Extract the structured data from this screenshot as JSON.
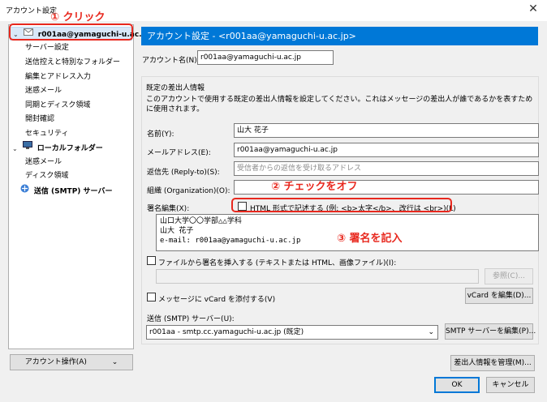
{
  "window": {
    "title": "アカウント設定",
    "close_glyph": "✕"
  },
  "sidebar": {
    "account": "r001aa@yamaguchi-u.ac.jp",
    "items": [
      {
        "label": "サーバー設定"
      },
      {
        "label": "送信控えと特別なフォルダー"
      },
      {
        "label": "編集とアドレス入力"
      },
      {
        "label": "迷惑メール"
      },
      {
        "label": "同期とディスク領域"
      },
      {
        "label": "開封確認"
      },
      {
        "label": "セキュリティ"
      }
    ],
    "local_folders": "ローカルフォルダー",
    "local_items": [
      {
        "label": "迷惑メール"
      },
      {
        "label": "ディスク領域"
      }
    ],
    "smtp": "送信 (SMTP) サーバー",
    "account_ops": "アカウント操作(A)",
    "account_ops_chevron": "⌄"
  },
  "main": {
    "header": "アカウント設定 - <r001aa@yamaguchi-u.ac.jp>",
    "account_name_label": "アカウント名(N):",
    "account_name_value": "r001aa@yamaguchi-u.ac.jp",
    "identity_heading": "既定の差出人情報",
    "identity_desc": "このアカウントで使用する既定の差出人情報を設定してください。これはメッセージの差出人が誰であるかを表すために使用されます。",
    "name_label": "名前(Y):",
    "name_value": "山大 花子",
    "email_label": "メールアドレス(E):",
    "email_value": "r001aa@yamaguchi-u.ac.jp",
    "replyto_label": "返信先 (Reply-to)(S):",
    "replyto_placeholder": "受信者からの返信を受け取るアドレス",
    "org_label": "組織 (Organization)(O):",
    "org_value": "",
    "sig_label": "署名編集(X):",
    "html_checkbox_label": "HTML 形式で記述する (例: <b>太字</b>、改行は <br>)(L)",
    "signature_text": "山口大学〇〇学部△△学科\n山大 花子\ne-mail: r001aa@yamaguchi-u.ac.jp",
    "sig_file_label": "ファイルから署名を挿入する (テキストまたは HTML、画像ファイル)(I):",
    "browse_button": "参照(C)...",
    "vcard_label": "メッセージに vCard を添付する(V)",
    "vcard_button": "vCard を編集(D)...",
    "smtp_label": "送信 (SMTP) サーバー(U):",
    "smtp_value": "r001aa - smtp.cc.yamaguchi-u.ac.jp (既定)",
    "smtp_button": "SMTP サーバーを編集(P)...",
    "manage_identities": "差出人情報を管理(M)...",
    "ok": "OK",
    "cancel": "キャンセル"
  },
  "annotations": {
    "click": "① クリック",
    "check_off": "② チェックをオフ",
    "write_sig": "③ 署名を記入"
  },
  "colors": {
    "accent": "#0078d7",
    "annotation": "#e8281e"
  }
}
